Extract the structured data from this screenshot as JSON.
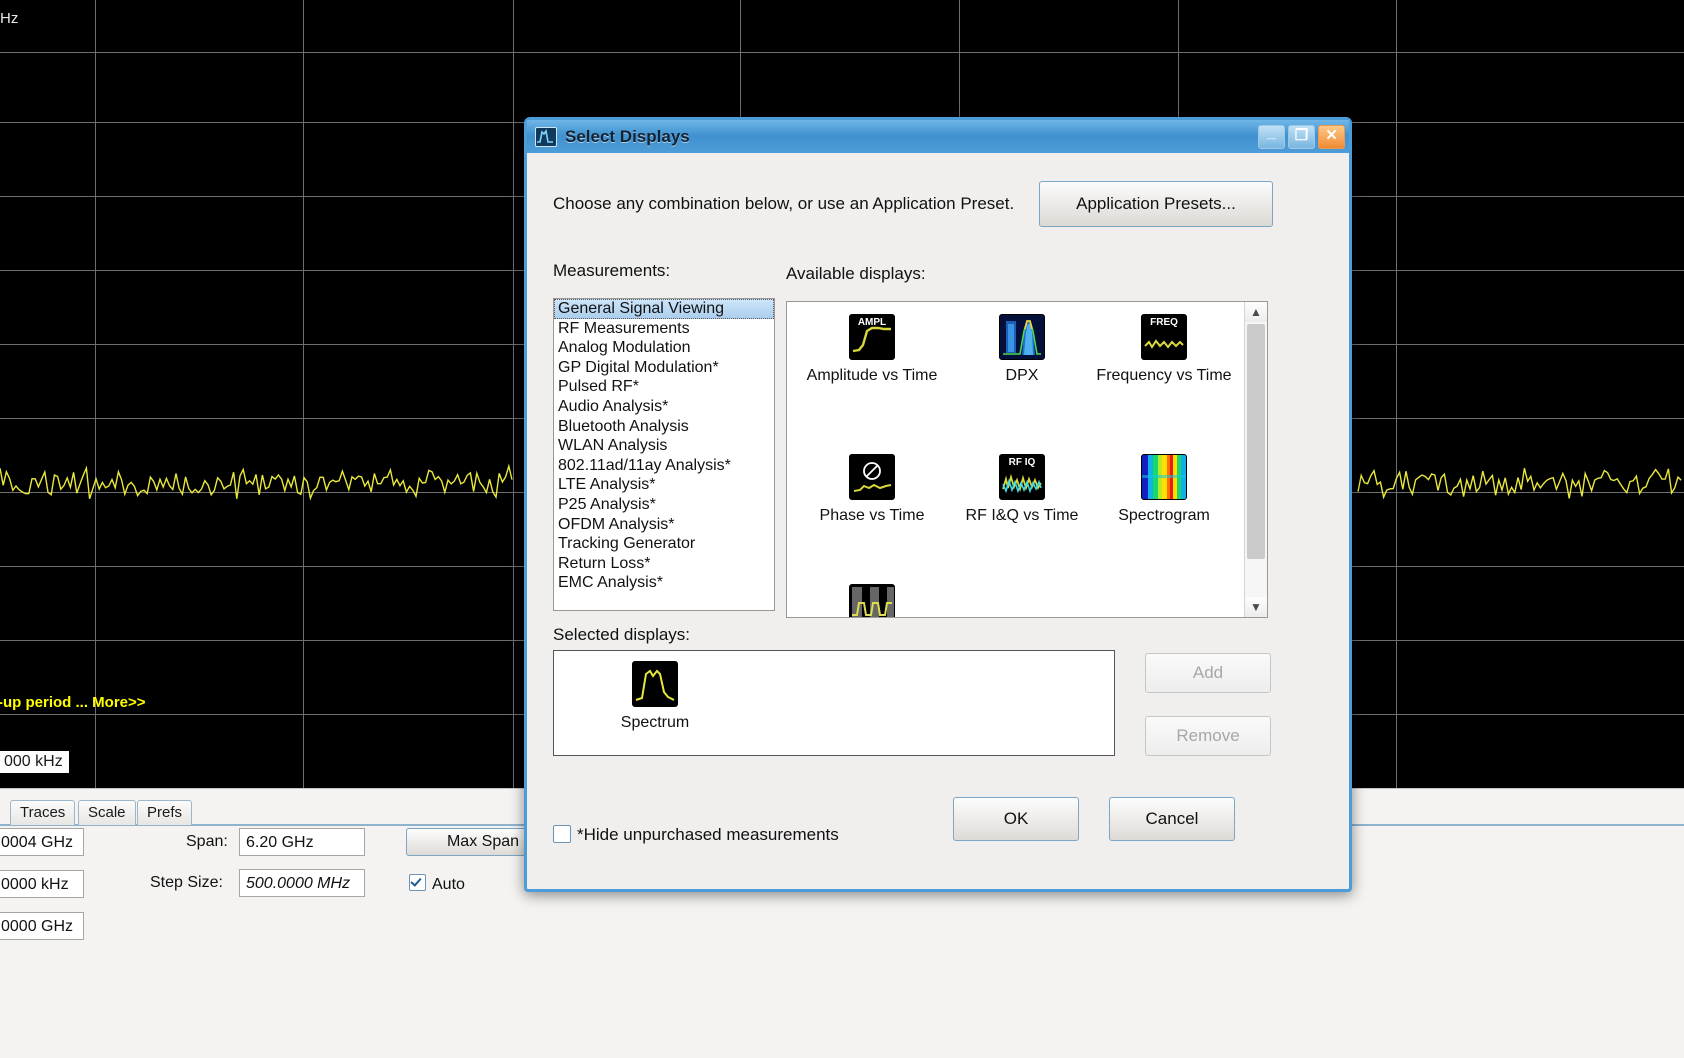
{
  "background": {
    "axis_label_top_left": "Hz",
    "status_text": "-up period ... More>>",
    "readout_khz": "000 kHz",
    "tabs": [
      {
        "label": "Traces"
      },
      {
        "label": "Scale"
      },
      {
        "label": "Prefs"
      }
    ],
    "fields": [
      {
        "name": "freq-ghz-field",
        "value": "0004 GHz"
      },
      {
        "name": "offset-khz-field",
        "value": "0000 kHz"
      },
      {
        "name": "stop-ghz-field",
        "value": "0000 GHz"
      }
    ],
    "span_label": "Span:",
    "span_value": "6.20 GHz",
    "step_size_label": "Step Size:",
    "step_size_value": "500.0000 MHz",
    "max_span_button": "Max Span",
    "auto_checkbox": {
      "label": "Auto",
      "checked": true
    }
  },
  "dialog": {
    "title": "Select Displays",
    "window_buttons": {
      "minimize": "_",
      "maximize": "❐",
      "close": "✕"
    },
    "header_text": "Choose any combination below, or use an Application Preset.",
    "presets_button": "Application Presets...",
    "measurements_label": "Measurements:",
    "measurements": [
      {
        "label": "General Signal Viewing",
        "selected": true
      },
      {
        "label": "RF Measurements",
        "selected": false
      },
      {
        "label": "Analog Modulation",
        "selected": false
      },
      {
        "label": "GP Digital Modulation*",
        "selected": false
      },
      {
        "label": "Pulsed RF*",
        "selected": false
      },
      {
        "label": "Audio Analysis*",
        "selected": false
      },
      {
        "label": "Bluetooth Analysis",
        "selected": false
      },
      {
        "label": "WLAN Analysis",
        "selected": false
      },
      {
        "label": "802.11ad/11ay Analysis*",
        "selected": false
      },
      {
        "label": "LTE Analysis*",
        "selected": false
      },
      {
        "label": "P25 Analysis*",
        "selected": false
      },
      {
        "label": "OFDM Analysis*",
        "selected": false
      },
      {
        "label": "Tracking Generator",
        "selected": false
      },
      {
        "label": "Return Loss*",
        "selected": false
      },
      {
        "label": "EMC Analysis*",
        "selected": false
      }
    ],
    "available_label": "Available displays:",
    "available_displays": [
      {
        "label": "Amplitude vs Time",
        "icon": "amplitude-vs-time-icon",
        "icon_text": "AMPL"
      },
      {
        "label": "DPX",
        "icon": "dpx-icon",
        "icon_text": ""
      },
      {
        "label": "Frequency vs Time",
        "icon": "frequency-vs-time-icon",
        "icon_text": "FREQ"
      },
      {
        "label": "Phase vs Time",
        "icon": "phase-vs-time-icon",
        "icon_text": ""
      },
      {
        "label": "RF I&Q vs Time",
        "icon": "rf-iq-vs-time-icon",
        "icon_text": "RF IQ"
      },
      {
        "label": "Spectrogram",
        "icon": "spectrogram-icon",
        "icon_text": ""
      }
    ],
    "selected_label": "Selected displays:",
    "selected_displays": [
      {
        "label": "Spectrum",
        "icon": "spectrum-icon"
      }
    ],
    "add_button": "Add",
    "remove_button": "Remove",
    "hide_unpurchased": {
      "label": "*Hide unpurchased measurements",
      "checked": false
    },
    "ok_button": "OK",
    "cancel_button": "Cancel"
  },
  "colors": {
    "trace": "#e8e83c",
    "accent_blue": "#4b9cd8",
    "status_yellow": "#ffff00",
    "close_orange": "#f08b33"
  }
}
